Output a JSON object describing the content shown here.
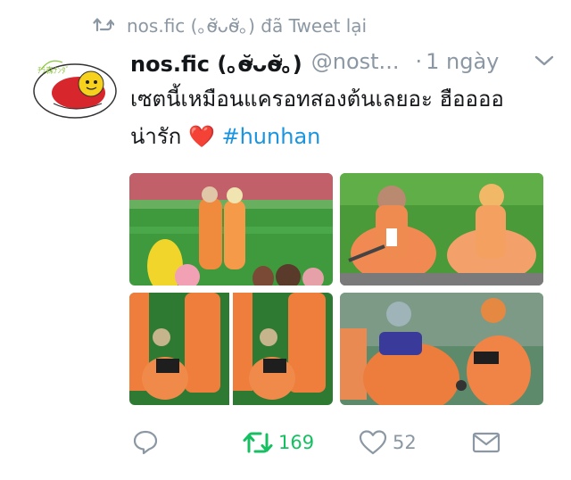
{
  "retweet_header": {
    "icon": "retweet-icon",
    "text": "nos.fic (｡ơ̴̆ᴗơ̴̆｡) đã Tweet lại"
  },
  "tweet": {
    "author_name": "nos.fic (｡ơ̴̆ᴗơ̴̆｡)",
    "handle": "@nost...",
    "separator": "·",
    "time": "1 ngày",
    "text_line1": "เซตนี้เหมือนแครอทสองต้นเลยอะ ฮืออออ",
    "text_line2_prefix": "น่ารัก",
    "emoji": "❤️",
    "hashtag": "#hunhan"
  },
  "actions": {
    "reply": {
      "icon": "reply-icon"
    },
    "retweet": {
      "icon": "retweet-icon",
      "count": "169",
      "color": "#17bf63"
    },
    "like": {
      "icon": "heart-icon",
      "count": "52"
    },
    "dm": {
      "icon": "mail-icon"
    }
  },
  "colors": {
    "muted": "#8b98a4",
    "link": "#1b95e0",
    "retweeted": "#17bf63",
    "text": "#14171a"
  }
}
